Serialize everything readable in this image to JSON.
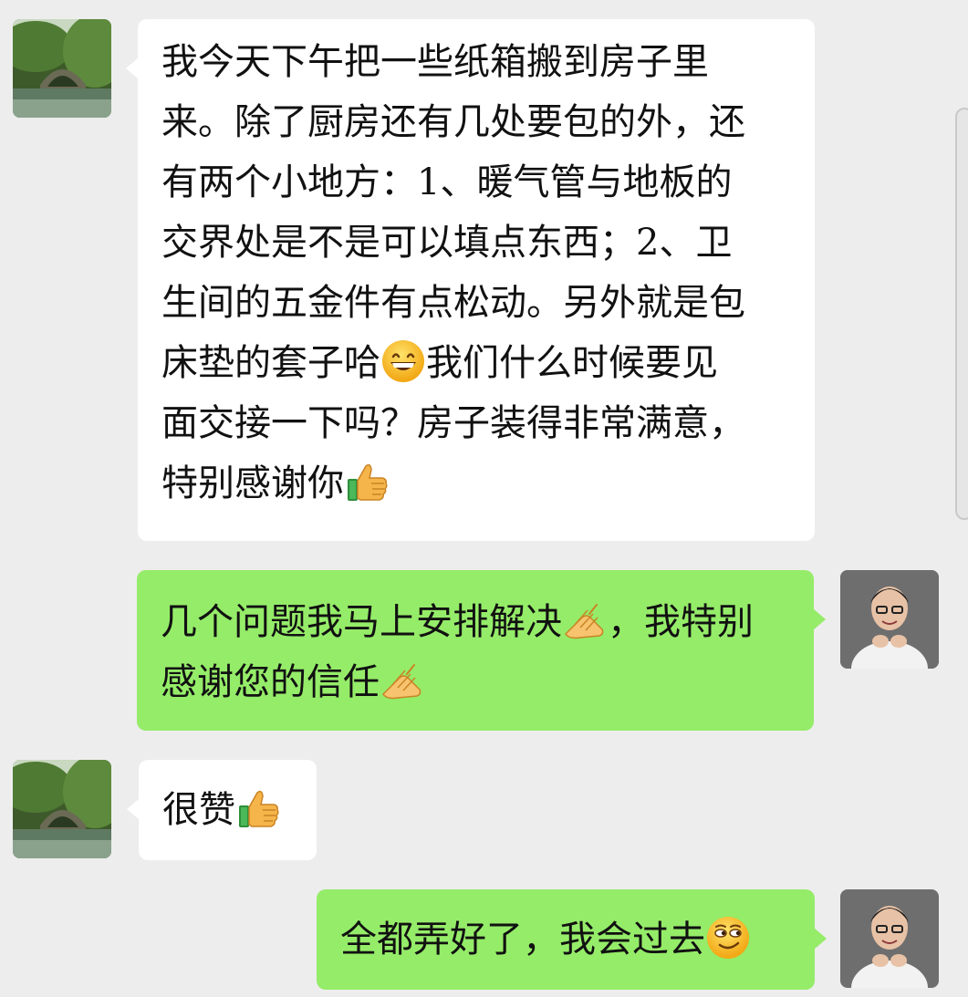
{
  "messages": [
    {
      "sender": "other",
      "lines": [
        [
          "我今天下午把一些纸箱搬到房子里"
        ],
        [
          "来。除了厨房还有几处要包的外，还"
        ],
        [
          "有两个小地方：1、暖气管与地板的"
        ],
        [
          "交界处是不是可以填点东西；2、卫"
        ],
        [
          "生间的五金件有点松动。另外就是包"
        ],
        [
          "床垫的套子哈",
          "{grin}",
          "我们什么时候要见"
        ],
        [
          "面交接一下吗？房子装得非常满意，"
        ],
        [
          "特别感谢你",
          "{thumbs}"
        ]
      ]
    },
    {
      "sender": "me",
      "lines": [
        [
          "几个问题我马上安排解决",
          "{fist}",
          "，我特别"
        ],
        [
          "感谢您的信任",
          "{fist}"
        ]
      ]
    },
    {
      "sender": "other",
      "lines": [
        [
          "很赞",
          "{thumbs}"
        ]
      ]
    },
    {
      "sender": "me",
      "lines": [
        [
          "全都弄好了，我会过去",
          "{sly}"
        ]
      ]
    }
  ],
  "emoji_names": {
    "grin": "grinning-face-icon",
    "thumbs": "thumbs-up-icon",
    "fist": "fist-bump-icon",
    "sly": "smirking-face-icon"
  },
  "colors": {
    "background": "#ededed",
    "incoming_bubble": "#ffffff",
    "outgoing_bubble": "#95ec69",
    "text": "#111111"
  }
}
